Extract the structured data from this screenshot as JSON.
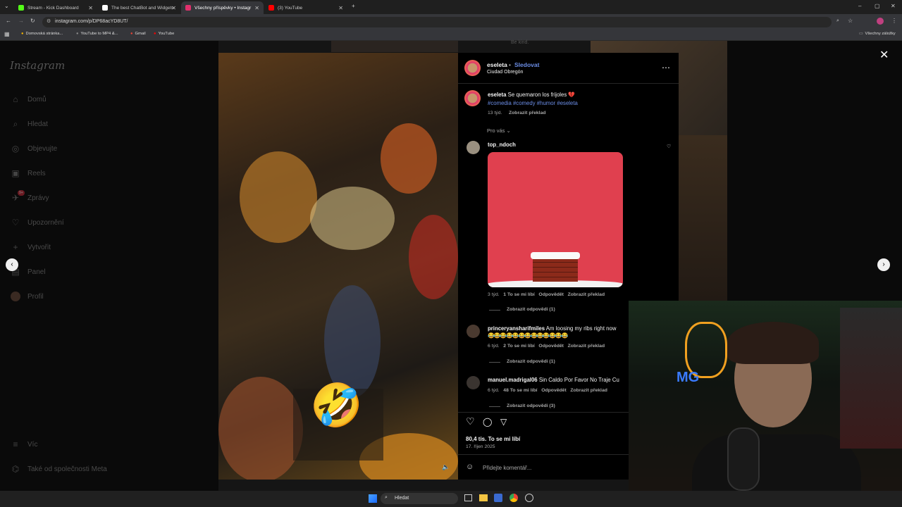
{
  "browser": {
    "tabs": [
      {
        "title": "Stream - Kick Dashboard",
        "color": "#53fc18"
      },
      {
        "title": "The best ChatBot and Widgets",
        "color": "#ffffff"
      },
      {
        "title": "Všechny příspěvky • Instagr",
        "color": "#e1306c"
      },
      {
        "title": "(3) YouTube",
        "color": "#ff0000"
      }
    ],
    "url": "instagram.com/p/DP68acYD8UT/",
    "bookmarks": [
      "Domovská stránka...",
      "YouTube to MP4 &...",
      "Gmail",
      "YouTube"
    ],
    "bookmarks_right": "Všechny záložky",
    "top_hint": "Be kind."
  },
  "sidebar": {
    "logo": "Instagram",
    "items": [
      {
        "label": "Domů",
        "icon": "home-icon"
      },
      {
        "label": "Hledat",
        "icon": "search-icon"
      },
      {
        "label": "Objevujte",
        "icon": "compass-icon"
      },
      {
        "label": "Reels",
        "icon": "reels-icon"
      },
      {
        "label": "Zprávy",
        "icon": "messenger-icon",
        "badge": "9+"
      },
      {
        "label": "Upozornění",
        "icon": "heart-icon"
      },
      {
        "label": "Vytvořit",
        "icon": "plus-icon"
      },
      {
        "label": "Panel",
        "icon": "dashboard-icon"
      },
      {
        "label": "Profil",
        "icon": "avatar-icon"
      }
    ],
    "more": "Víc",
    "meta": "Také od společnosti Meta"
  },
  "post": {
    "author": "eseleta",
    "follow": "Sledovat",
    "location": "Ciudad Obregón",
    "caption_user": "eseleta",
    "caption_text": "Se quemaron los frijoles 💔",
    "hashtags": "#comedia #comedy #humor #eseleta",
    "caption_age": "13 týd.",
    "translate": "Zobrazit překlad",
    "for_you": "Pro vás",
    "likes": "80,4 tis. To se mi líbí",
    "date": "17. říjen 2025",
    "add_comment": "Přidejte komentář..."
  },
  "comments": [
    {
      "user": "top_ndoch",
      "text": "",
      "age": "3 týd.",
      "likes": "1 To se mi líbí",
      "reply": "Odpovědět",
      "translate": "Zobrazit překlad",
      "replies": "Zobrazit odpovědi (1)"
    },
    {
      "user": "princeryansharifmiles",
      "text": "Am loosing my ribs right now",
      "emojis": "😂😂😂😂😂😂😂😂😂😂😂😂😂",
      "age": "6 týd.",
      "likes": "2 To se mi líbí",
      "reply": "Odpovědět",
      "translate": "Zobrazit překlad",
      "replies": "Zobrazit odpovědi (1)"
    },
    {
      "user": "manuel.madrigal06",
      "text": "Sin Caldo Por Favor No Traje Cu",
      "age": "6 týd.",
      "likes": "48 To se mi líbí",
      "reply": "Odpovědět",
      "translate": "Zobrazit překlad",
      "replies": "Zobrazit odpovědi (3)"
    }
  ],
  "taskbar": {
    "search": "Hledat"
  },
  "colors": {
    "accent": "#6b8de6",
    "gif_red": "#e63946",
    "ig_bg": "#000000"
  }
}
